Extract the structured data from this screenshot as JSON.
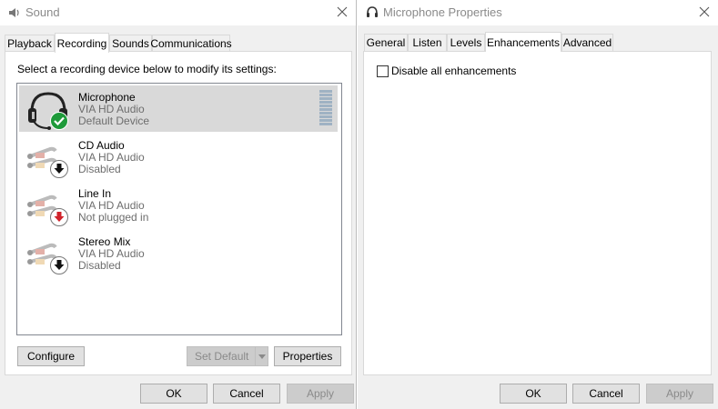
{
  "sound": {
    "title": "Sound",
    "tabs": [
      "Playback",
      "Recording",
      "Sounds",
      "Communications"
    ],
    "instruction": "Select a recording device below to modify its settings:",
    "devices": [
      {
        "name": "Microphone",
        "driver": "VIA HD Audio",
        "status": "Default Device",
        "icon": "headset-icon",
        "badge": "default-check-badge"
      },
      {
        "name": "CD Audio",
        "driver": "VIA HD Audio",
        "status": "Disabled",
        "icon": "audio-cable-icon",
        "badge": "disabled-arrow-badge"
      },
      {
        "name": "Line In",
        "driver": "VIA HD Audio",
        "status": "Not plugged in",
        "icon": "audio-cable-icon",
        "badge": "unplugged-arrow-badge"
      },
      {
        "name": "Stereo Mix",
        "driver": "VIA HD Audio",
        "status": "Disabled",
        "icon": "audio-cable-icon",
        "badge": "disabled-arrow-badge"
      }
    ],
    "buttons": {
      "configure": "Configure",
      "set_default": "Set Default",
      "properties": "Properties",
      "ok": "OK",
      "cancel": "Cancel",
      "apply": "Apply"
    }
  },
  "mic_props": {
    "title": "Microphone Properties",
    "tabs": [
      "General",
      "Listen",
      "Levels",
      "Enhancements",
      "Advanced"
    ],
    "checkbox_label": "Disable all enhancements",
    "checkbox_checked": false,
    "buttons": {
      "ok": "OK",
      "cancel": "Cancel",
      "apply": "Apply"
    }
  },
  "colors": {
    "selected_row": "#d9d9d9",
    "check_green": "#1e9a3a",
    "unplugged_red": "#d0222a",
    "meter": "#9fb2c3"
  }
}
